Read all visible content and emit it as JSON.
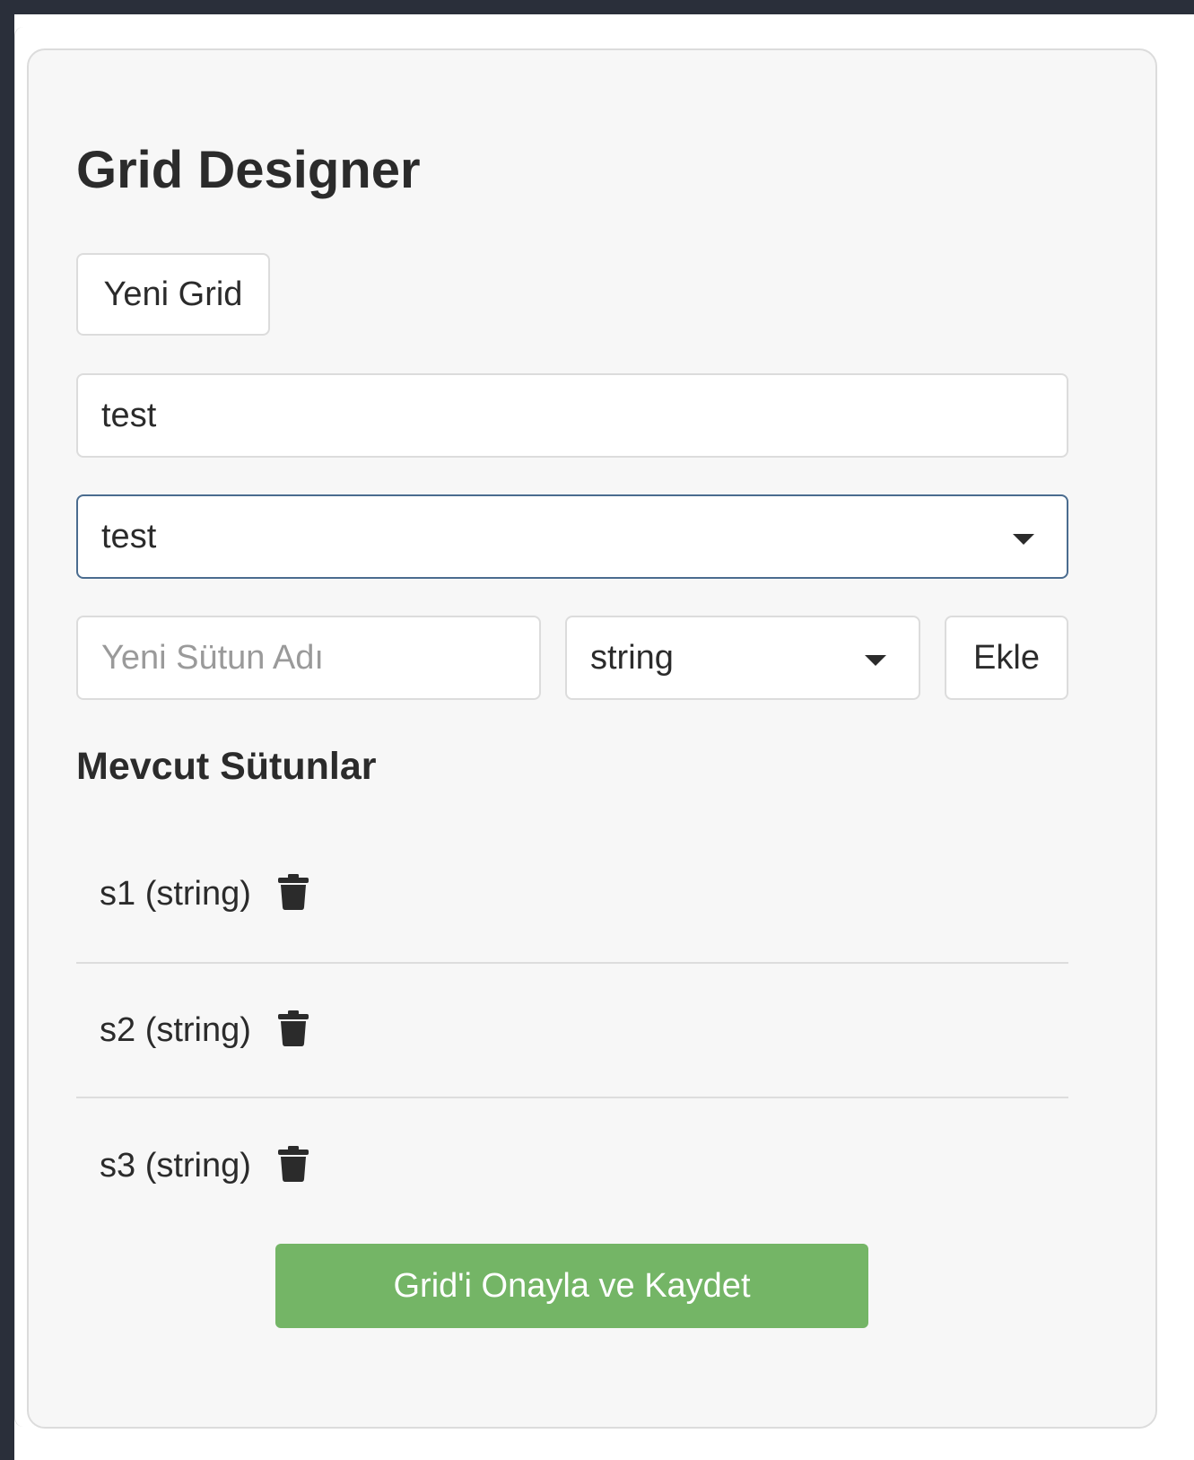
{
  "designer": {
    "title": "Grid Designer",
    "new_grid_button": "Yeni Grid",
    "grid_name_value": "test",
    "grid_select_value": "test",
    "new_column_placeholder": "Yeni Sütun Adı",
    "column_type_value": "string",
    "add_button": "Ekle",
    "columns_heading": "Mevcut Sütunlar",
    "columns": [
      {
        "label": "s1 (string)",
        "icon": "trash-icon"
      },
      {
        "label": "s2 (string)",
        "icon": "trash-icon"
      },
      {
        "label": "s3 (string)",
        "icon": "trash-icon"
      }
    ],
    "save_button": "Grid'i Onayla ve Kaydet"
  },
  "colors": {
    "panel_bg": "#f7f7f7",
    "frame_dark": "#2a2f3a",
    "focus_border": "#4a6c8f",
    "save_button_bg": "#74b566",
    "text": "#2b2b2b",
    "placeholder": "#9a9a9a"
  }
}
